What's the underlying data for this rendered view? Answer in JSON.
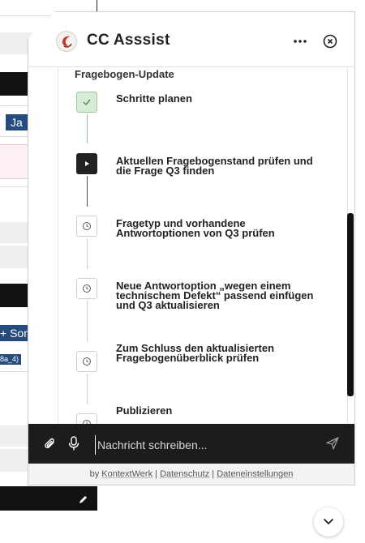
{
  "background": {
    "chip_top": "Ja",
    "chip_mid": "+ Son",
    "chip_small": "8a_4)"
  },
  "widget": {
    "title": "CC Asssist",
    "section_title": "Fragebogen-Update",
    "steps": [
      {
        "label": "Schritte planen",
        "status": "done"
      },
      {
        "label": "Aktuellen Fragebogenstand prüfen und die Frage Q3 finden",
        "status": "active"
      },
      {
        "label": "Fragetyp und vorhandene Antwortoptionen von Q3 prüfen",
        "status": "pending"
      },
      {
        "label": "Neue Antwortoption „wegen einem technischem Defekt“ passend einfügen und Q3 aktualisieren",
        "status": "pending"
      },
      {
        "label": "Zum Schluss den aktualisierten Fragebogenüberblick prüfen",
        "status": "pending"
      },
      {
        "label": "Publizieren",
        "status": "pending"
      }
    ],
    "composer": {
      "placeholder": "Nachricht schreiben..."
    },
    "footer": {
      "prefix": "by",
      "brand": "KontextWerk",
      "sep": "|",
      "privacy": "Datenschutz",
      "file_settings": "Dateneinstellungen"
    }
  },
  "icons": {
    "more": "more-horizontal-icon",
    "close": "close-circle-icon",
    "attach": "paperclip-icon",
    "mic": "microphone-icon",
    "send": "send-icon",
    "scroll_down": "chevron-down-icon"
  },
  "colors": {
    "done_bg": "#d7ecd6",
    "active_bg": "#222222",
    "composer_bg": "#1c1c1c",
    "chip_blue": "#254c7c"
  }
}
